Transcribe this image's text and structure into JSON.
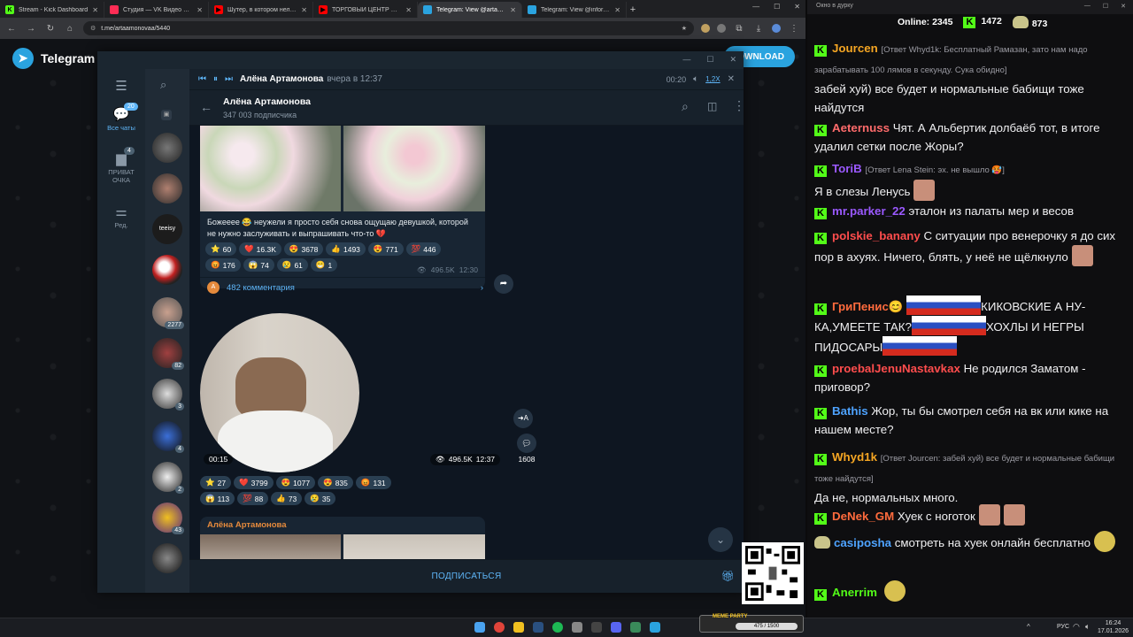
{
  "browser": {
    "tabs": [
      {
        "label": "Stream - Kick Dashboard",
        "fav": "K",
        "color": "#53fc18"
      },
      {
        "label": "Студия — VK Видео Live",
        "fav": "",
        "color": "#ff2d55"
      },
      {
        "label": "Шутер, в котором нельзя стр",
        "fav": "▶",
        "color": "#ff0000"
      },
      {
        "label": "ТОРГОВЫЙ ЦЕНТР СМЕРТИ -",
        "fav": "▶",
        "color": "#ff0000"
      },
      {
        "label": "Telegram: View @artaamonovaa",
        "fav": "",
        "color": "#2aa3df"
      },
      {
        "label": "Telegram: View @informatorz",
        "fav": "",
        "color": "#2aa3df"
      }
    ],
    "new_tab": "+",
    "url": "t.me/artaamonovaa/5440"
  },
  "tg_page": {
    "brand": "Telegram",
    "download": "DOWNLOAD"
  },
  "player": {
    "title": "Алёна Артамонова",
    "when": "вчера в 12:37",
    "time": "00:20",
    "speed": "1,2X"
  },
  "channel": {
    "name": "Алёна Артамонова",
    "subs": "347 003 подписчика"
  },
  "nav": {
    "all_chats": "Все чаты",
    "all_badge": "20",
    "private": "ПРИВАТ ОЧКА",
    "private_badge": "4",
    "edit": "Ред."
  },
  "chat_badges": [
    "2277",
    "82",
    "3",
    "4",
    "2",
    "43"
  ],
  "post1": {
    "text": "Божееее 😂 неужели я просто себя снова ощущаю девушкой, которой не нужно заслуживать и выпрашивать что-то 💔",
    "reactions": [
      "60",
      "16.3K",
      "3678",
      "1493",
      "771",
      "446",
      "176",
      "74",
      "61",
      "1"
    ],
    "views": "496.5K",
    "time": "12:30",
    "comments": "482 комментария"
  },
  "post2": {
    "duration": "00:15",
    "views": "496.5K",
    "time": "12:37",
    "reactions": [
      "27",
      "3799",
      "1077",
      "835",
      "131",
      "113",
      "88",
      "73",
      "35"
    ],
    "comments": "1608",
    "translate": "➜A"
  },
  "post3": {
    "author": "Алёна Артамонова"
  },
  "subscribe": "ПОДПИСАТЬСЯ",
  "colors": {
    "accent": "#5eb5f7",
    "bubble": "#182533",
    "kick": "#53fc18"
  },
  "chatwin": {
    "title": "Окно в дурку",
    "online_label": "Online:",
    "online": "2345",
    "kick_count": "1472",
    "other_count": "873"
  },
  "messages": [
    {
      "user": "Jourcen",
      "color": "#f5a623",
      "reply": "[Ответ Whyd1k: Бесплатный Рамазан, зато нам надо зарабатывать 100 лямов в секунду. Сука обидно]",
      "text": "забей хуй) все будет и нормальные бабищи тоже найдутся"
    },
    {
      "user": "Aeternuss",
      "color": "#ff6b6b",
      "text": "Чят. А Альбертик долбаёб тот, в итоге удалил сетки после Жоры?"
    },
    {
      "user": "ToriB",
      "color": "#9b59ff",
      "reply": "[Ответ Lena Stein: эх. не вышло 🥵]",
      "text": "Я в слезы Ленусь"
    },
    {
      "user": "mr.parker_22",
      "color": "#9b59ff",
      "text": "эталон из палаты мер и весов"
    },
    {
      "user": "polskie_banany",
      "color": "#ff4d4d",
      "text": "С ситуации про венерочку я до сих пор в ахуях. Ничего, блять, у неё не щёлкнуло"
    },
    {
      "user": "ГриПенис😊",
      "color": "#ff6b3d",
      "text": "КИКОВСКИЕ А НУ-КА,УМЕЕТЕ ТАК?",
      "text2": "ХОХЛЫ И НЕГРЫ ПИДОСАРЫ"
    },
    {
      "user": "proebalJenuNastavkax",
      "color": "#ff4d4d",
      "text": "Не родился Заматом - приговор?"
    },
    {
      "user": "Bathis",
      "color": "#4ea3ff",
      "text": "Жор, ты бы смотрел себя на вк или кике на нашем месте?"
    },
    {
      "user": "Whyd1k",
      "color": "#f5a623",
      "reply": "[Ответ Jourcen: забей хуй) все будет и нормальные бабищи тоже найдутся]",
      "text": "Да не, нормальных много."
    },
    {
      "user": "DeNek_GM",
      "color": "#ff6b3d",
      "text": "Хуек с ноготок"
    },
    {
      "user": "casiposha",
      "color": "#4ea3ff",
      "text": "смотреть на хуек онлайн бесплатно"
    },
    {
      "user": "Anerrim",
      "color": "#53fc18",
      "text": ""
    }
  ],
  "widget": {
    "title": "MEME PARTY",
    "value": "475 / 1500"
  },
  "taskbar": {
    "lang": "РУС",
    "time": "16:24",
    "date": "17.01.2026"
  }
}
